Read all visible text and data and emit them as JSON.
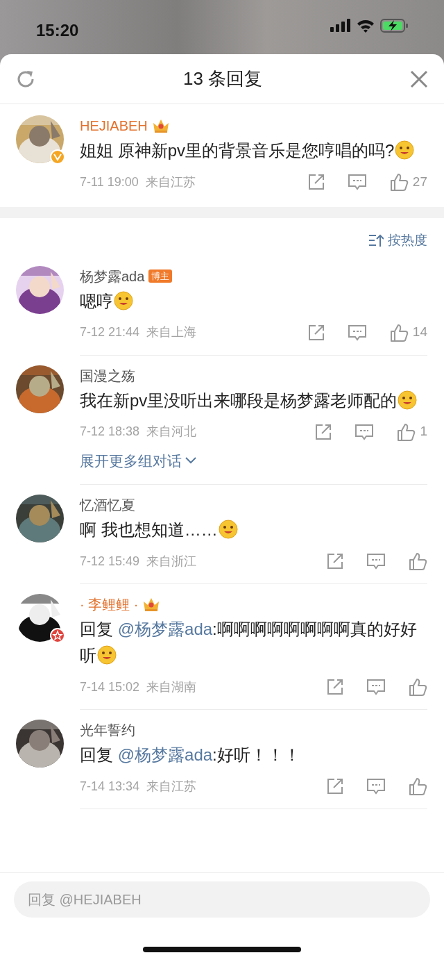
{
  "status_bar": {
    "time": "15:20"
  },
  "header": {
    "title": "13 条回复"
  },
  "main_comment": {
    "name": "HEJIABEH",
    "vip": true,
    "verified": true,
    "star_member": false,
    "badge": {
      "kind": "crown"
    },
    "content": [
      {
        "kind": "text",
        "text": "姐姐 原神新pv里的背景音乐是您哼唱的吗?"
      },
      {
        "kind": "emoji"
      }
    ],
    "time": "7-11 19:00",
    "location": "来自江苏",
    "likes": "27"
  },
  "sort": {
    "label": "按热度"
  },
  "replies": [
    {
      "name": "杨梦露ada",
      "vip": false,
      "verified": false,
      "star_member": false,
      "badge": {
        "kind": "tag",
        "label": "博主"
      },
      "content": [
        {
          "kind": "text",
          "text": "嗯哼"
        },
        {
          "kind": "emoji"
        }
      ],
      "time": "7-12 21:44",
      "location": "来自上海",
      "likes": "14"
    },
    {
      "name": "国漫之殇",
      "vip": false,
      "verified": false,
      "star_member": false,
      "content": [
        {
          "kind": "text",
          "text": "我在新pv里没听出来哪段是杨梦露老师配的"
        },
        {
          "kind": "emoji"
        }
      ],
      "time": "7-12 18:38",
      "location": "来自河北",
      "likes": "1",
      "expand": "展开更多组对话"
    },
    {
      "name": "忆酒忆夏",
      "vip": false,
      "verified": false,
      "star_member": false,
      "content": [
        {
          "kind": "text",
          "text": "啊  我也想知道……"
        },
        {
          "kind": "emoji"
        }
      ],
      "time": "7-12 15:49",
      "location": "来自浙江"
    },
    {
      "name": "· 李鲤鲤 ·",
      "vip": true,
      "verified": false,
      "star_member": true,
      "badge": {
        "kind": "crown"
      },
      "content": [
        {
          "kind": "text",
          "text": "回复 "
        },
        {
          "kind": "mention",
          "text": "@杨梦露ada"
        },
        {
          "kind": "text",
          "text": ":啊啊啊啊啊啊啊啊真的好好听"
        },
        {
          "kind": "emoji"
        }
      ],
      "time": "7-14 15:02",
      "location": "来自湖南"
    },
    {
      "name": "光年誓约",
      "vip": false,
      "verified": false,
      "star_member": false,
      "content": [
        {
          "kind": "text",
          "text": "回复 "
        },
        {
          "kind": "mention",
          "text": "@杨梦露ada"
        },
        {
          "kind": "text",
          "text": ":好听！！！"
        }
      ],
      "time": "7-14 13:34",
      "location": "来自江苏"
    }
  ],
  "reply_box": {
    "placeholder": "回复 @HEJIABEH"
  }
}
